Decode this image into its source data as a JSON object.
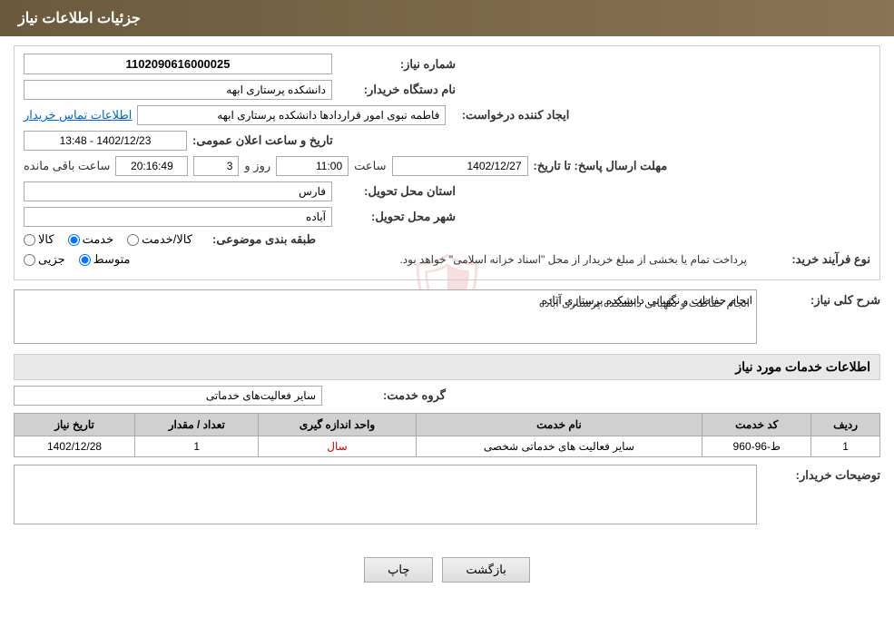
{
  "page": {
    "title": "جزئیات اطلاعات نیاز"
  },
  "header": {
    "title": "جزئیات اطلاعات نیاز"
  },
  "form": {
    "need_number_label": "شماره نیاز:",
    "need_number_value": "1102090616000025",
    "buyer_org_label": "نام دستگاه خریدار:",
    "buyer_org_value": "دانشکده پرستاری ابهه",
    "requester_label": "ایجاد کننده درخواست:",
    "requester_value": "فاطمه نبوی امور قراردادها دانشکده پرستاری ابهه",
    "contact_link": "اطلاعات تماس خریدار",
    "announce_date_label": "تاریخ و ساعت اعلان عمومی:",
    "announce_date_value": "1402/12/23 - 13:48",
    "deadline_label": "مهلت ارسال پاسخ: تا تاریخ:",
    "deadline_date": "1402/12/27",
    "deadline_time_label": "ساعت",
    "deadline_time": "11:00",
    "deadline_days_label": "روز و",
    "deadline_days": "3",
    "deadline_remaining_label": "ساعت باقی مانده",
    "deadline_remaining": "20:16:49",
    "province_label": "استان محل تحویل:",
    "province_value": "فارس",
    "city_label": "شهر محل تحویل:",
    "city_value": "آباده",
    "category_label": "طبقه بندی موضوعی:",
    "category_options": [
      "کالا",
      "خدمت",
      "کالا/خدمت"
    ],
    "category_selected": "خدمت",
    "purchase_type_label": "نوع فرآیند خرید:",
    "purchase_type_options": [
      "جزیی",
      "متوسط"
    ],
    "purchase_type_selected": "متوسط",
    "purchase_note": "پرداخت تمام یا بخشی از مبلغ خریدار از محل \"اسناد خزانه اسلامی\" خواهد بود.",
    "general_desc_label": "شرح کلی نیاز:",
    "general_desc_value": "انجام حفاظت و نگهبانی دانشکده پرستاری آباده",
    "services_section_title": "اطلاعات خدمات مورد نیاز",
    "service_group_label": "گروه خدمت:",
    "service_group_value": "سایر فعالیت‌های خدماتی",
    "table": {
      "headers": [
        "ردیف",
        "کد خدمت",
        "نام خدمت",
        "واحد اندازه گیری",
        "تعداد / مقدار",
        "تاریخ نیاز"
      ],
      "rows": [
        {
          "row": "1",
          "code": "ط-96-960",
          "name": "سایر فعالیت های خدماتی شخصی",
          "unit": "سال",
          "quantity": "1",
          "date": "1402/12/28"
        }
      ]
    },
    "buyer_notes_label": "توضیحات خریدار:",
    "buyer_notes_value": ""
  },
  "buttons": {
    "print": "چاپ",
    "back": "بازگشت"
  }
}
